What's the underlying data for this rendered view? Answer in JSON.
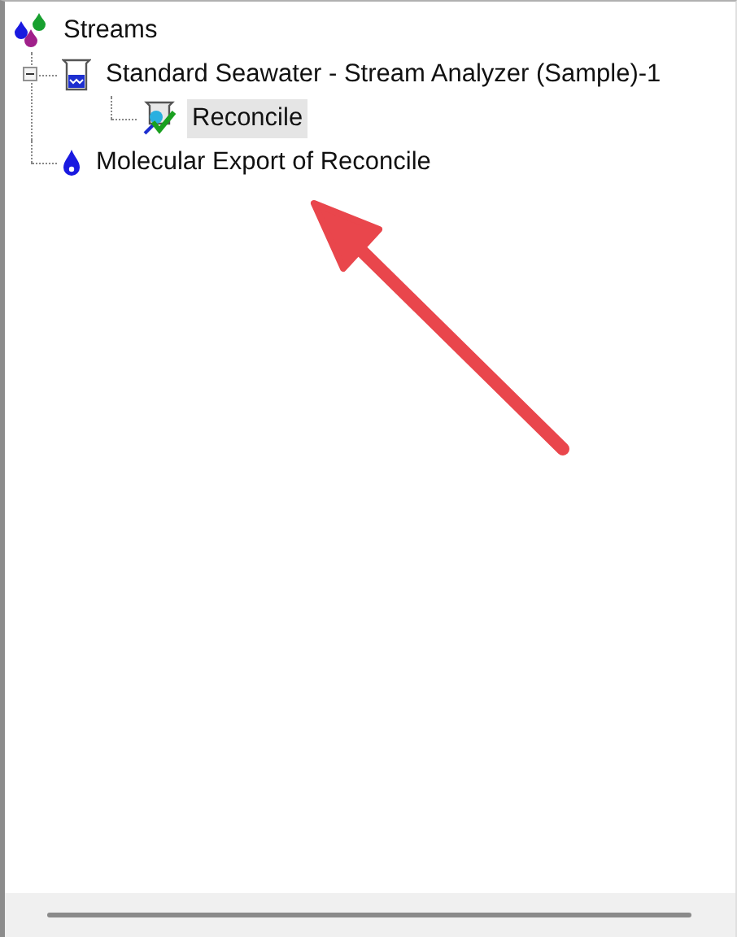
{
  "tree": [
    {
      "label": "Streams",
      "kind": "streams",
      "selected": false,
      "children": [
        {
          "label": "Standard Seawater - Stream Analyzer (Sample)-1",
          "kind": "sample",
          "selected": false,
          "expanded": true,
          "children": [
            {
              "label": "Reconcile",
              "kind": "reconcile",
              "selected": true
            }
          ]
        },
        {
          "label": "Molecular Export of Reconcile",
          "kind": "export",
          "selected": false
        }
      ]
    }
  ]
}
